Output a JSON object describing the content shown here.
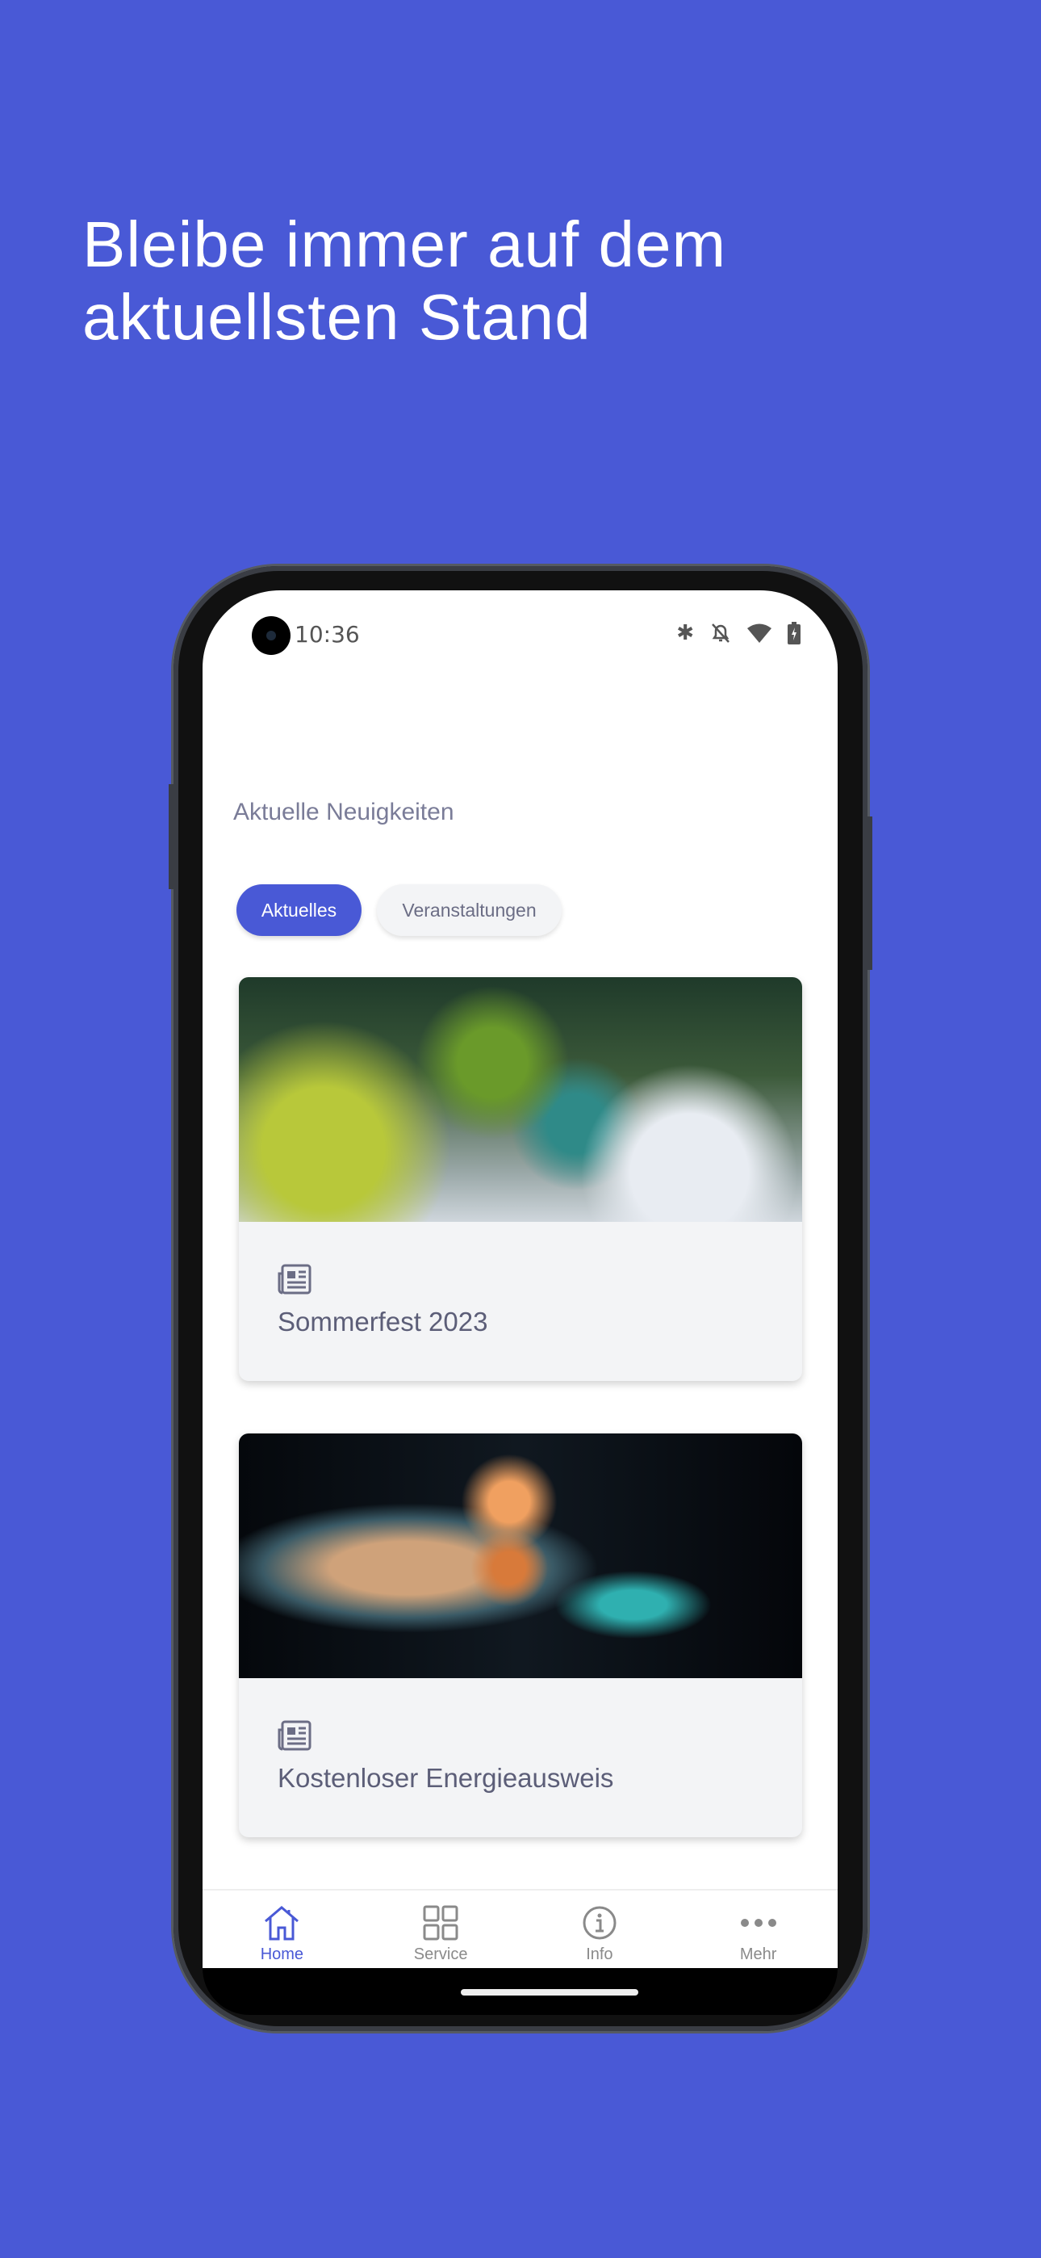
{
  "headline": {
    "line1": "Bleibe immer auf dem",
    "line2": "aktuellsten Stand"
  },
  "status_bar": {
    "time": "10:36",
    "icons": [
      "bluetooth-icon",
      "bell-off-icon",
      "wifi-icon",
      "battery-charging-icon"
    ]
  },
  "section_title": "Aktuelle Neuigkeiten",
  "filters": [
    {
      "label": "Aktuelles",
      "active": true
    },
    {
      "label": "Veranstaltungen",
      "active": false
    }
  ],
  "news": [
    {
      "title": "Sommerfest 2023",
      "icon": "newspaper-icon",
      "image": "festive table with glasses and flowers"
    },
    {
      "title": "Kostenloser Energieausweis",
      "icon": "newspaper-icon",
      "image": "light bulb"
    }
  ],
  "bottom_nav": [
    {
      "label": "Home",
      "icon": "home-icon",
      "active": true
    },
    {
      "label": "Service",
      "icon": "grid-icon",
      "active": false
    },
    {
      "label": "Info",
      "icon": "info-icon",
      "active": false
    },
    {
      "label": "Mehr",
      "icon": "more-icon",
      "active": false
    }
  ],
  "colors": {
    "background": "#4959d6",
    "accent": "#4959d6",
    "card": "#f3f4f6"
  }
}
